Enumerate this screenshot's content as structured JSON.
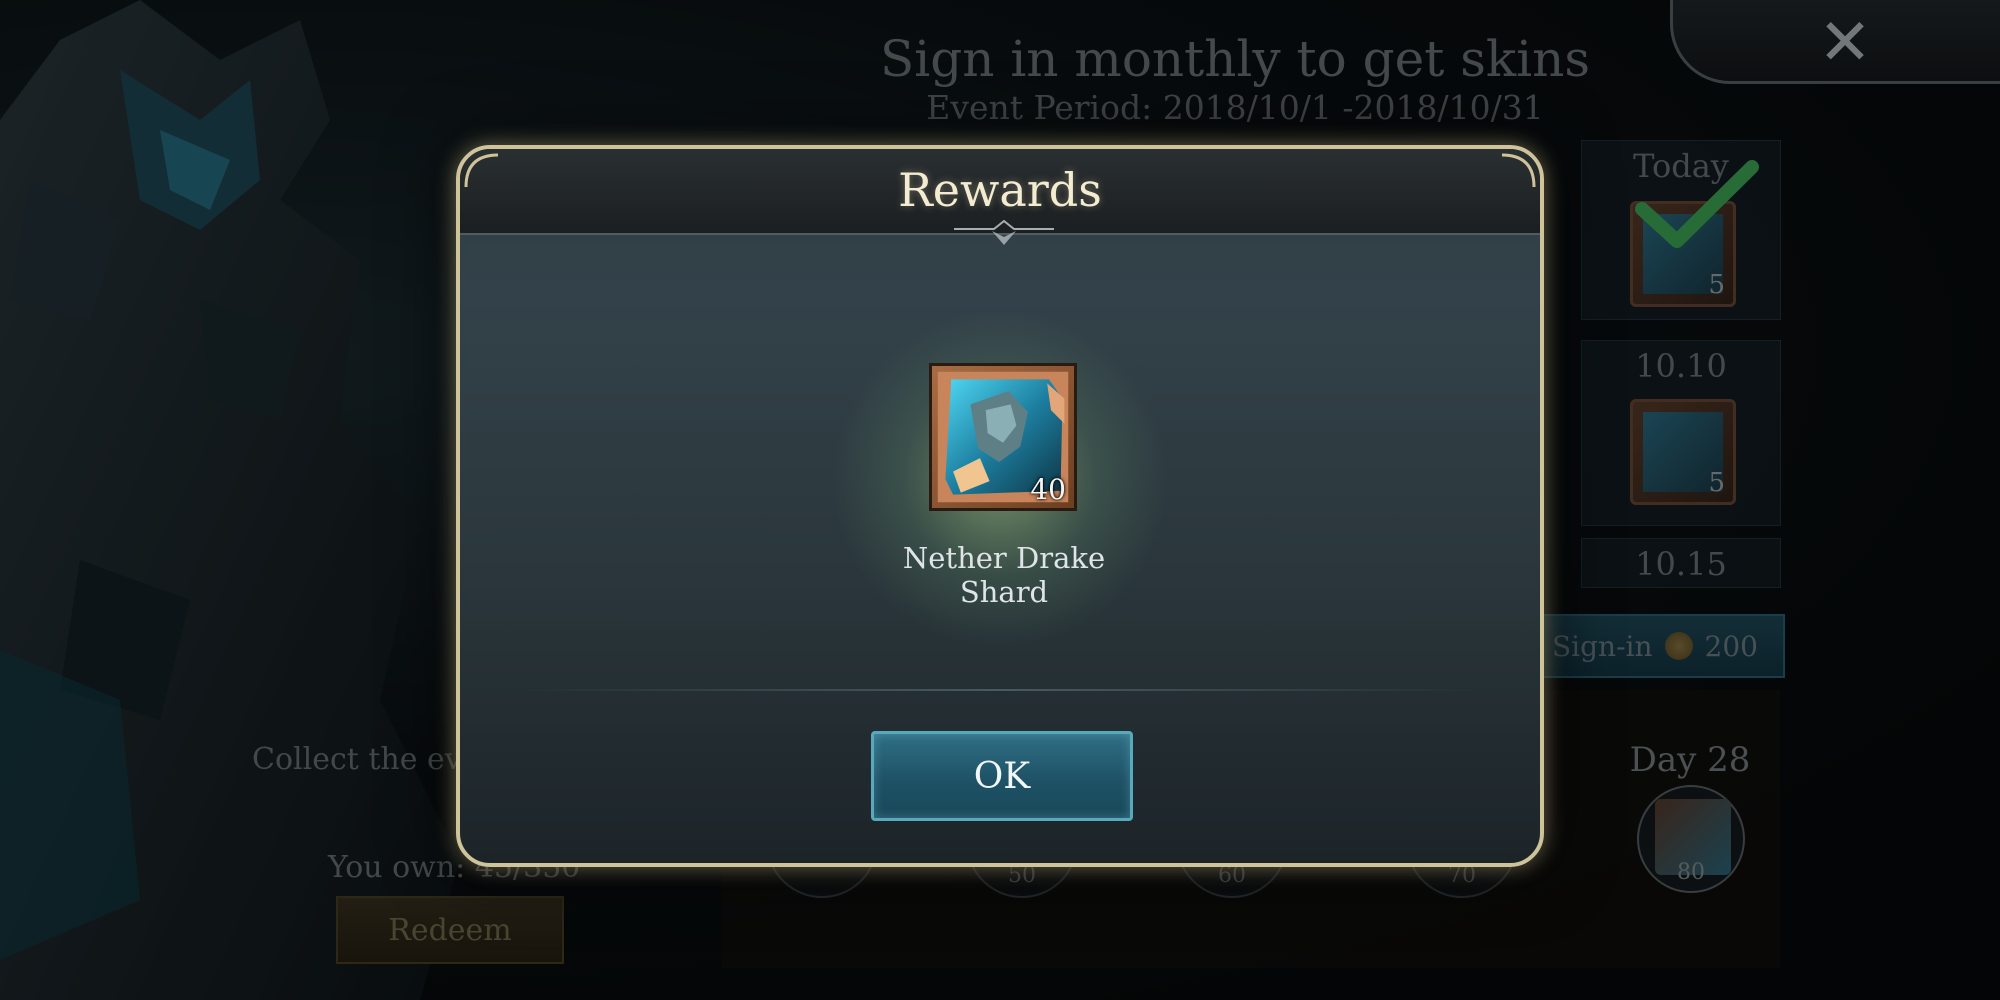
{
  "background": {
    "event_title": "Sign in monthly to get skins",
    "event_period": "Event Period: 2018/10/1 -2018/10/31",
    "days": [
      {
        "label": "Today",
        "quantity": "5",
        "claimed": true
      },
      {
        "label": "10.10",
        "quantity": "5",
        "claimed": false
      },
      {
        "label": "10.15",
        "quantity": "",
        "claimed": false
      }
    ],
    "signin_button": {
      "label": "Sign-in",
      "cost": "200",
      "icon": "coin-icon"
    },
    "milestones": [
      "50",
      "60",
      "70"
    ],
    "final_milestone": {
      "label": "Day 28",
      "quantity": "80"
    },
    "collect_text": "Collect the ever",
    "own_text": "You own: 45/350",
    "redeem_label": "Redeem",
    "close_icon": "close-icon"
  },
  "modal": {
    "title": "Rewards",
    "reward": {
      "name_line1": "Nether Drake",
      "name_line2": "Shard",
      "quantity": "40",
      "icon": "nether-drake-shard-icon"
    },
    "ok_label": "OK"
  },
  "colors": {
    "modal_border": "#cfc39a",
    "ok_button": "#1f5266",
    "title_text": "#f3ecd2"
  }
}
